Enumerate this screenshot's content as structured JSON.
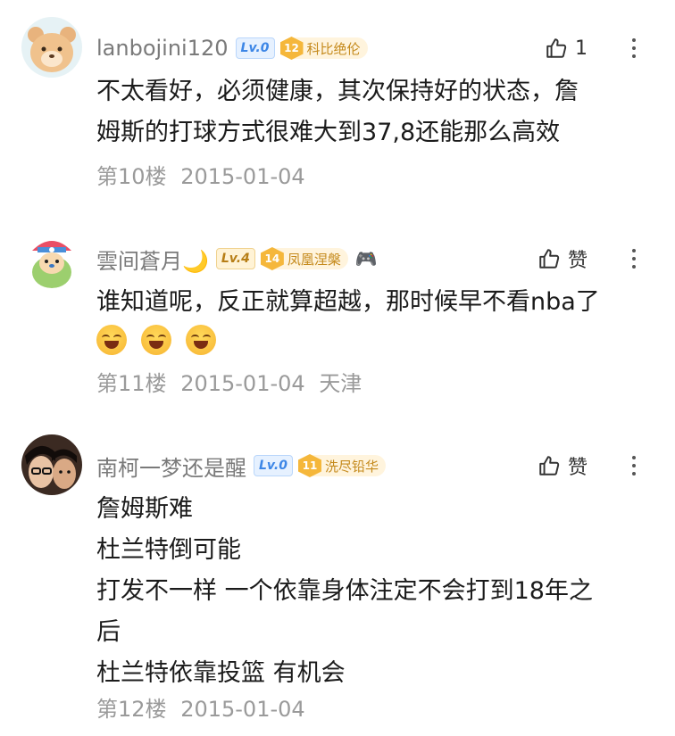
{
  "comments": [
    {
      "username": "lanbojini120",
      "level": "Lv.0",
      "badge_num": "12",
      "badge_label": "科比绝伦",
      "likes": "1",
      "lines": [
        "不太看好，必须健康，其次保持好的状态，詹",
        "姆斯的打球方式很难大到37,8还能那么高效"
      ],
      "floor": "第10楼",
      "date": "2015-01-04",
      "location": ""
    },
    {
      "username": "雲间蒼月🌙",
      "level": "Lv.4",
      "badge_num": "14",
      "badge_label": "凤凰涅槃",
      "extra_icon": "🎮",
      "likes": "赞",
      "lines": [
        "谁知道呢，反正就算超越，那时候早不看nba了"
      ],
      "emojis": 3,
      "floor": "第11楼",
      "date": "2015-01-04",
      "location": "天津"
    },
    {
      "username": "南柯一梦还是醒",
      "level": "Lv.0",
      "badge_num": "11",
      "badge_label": "洗尽铅华",
      "likes": "赞",
      "lines": [
        "詹姆斯难",
        "杜兰特倒可能",
        "打发不一样 一个依靠身体注定不会打到18年之",
        "后",
        "杜兰特依靠投篮 有机会"
      ],
      "floor": "第12楼",
      "date": "2015-01-04",
      "location": ""
    }
  ],
  "icons": {
    "like": "thumbs-up-icon",
    "more": "more-vertical-icon"
  },
  "colors": {
    "meta": "#9a9a9a",
    "badge": "#f5b73b",
    "level_blue": "#3c86e6"
  }
}
